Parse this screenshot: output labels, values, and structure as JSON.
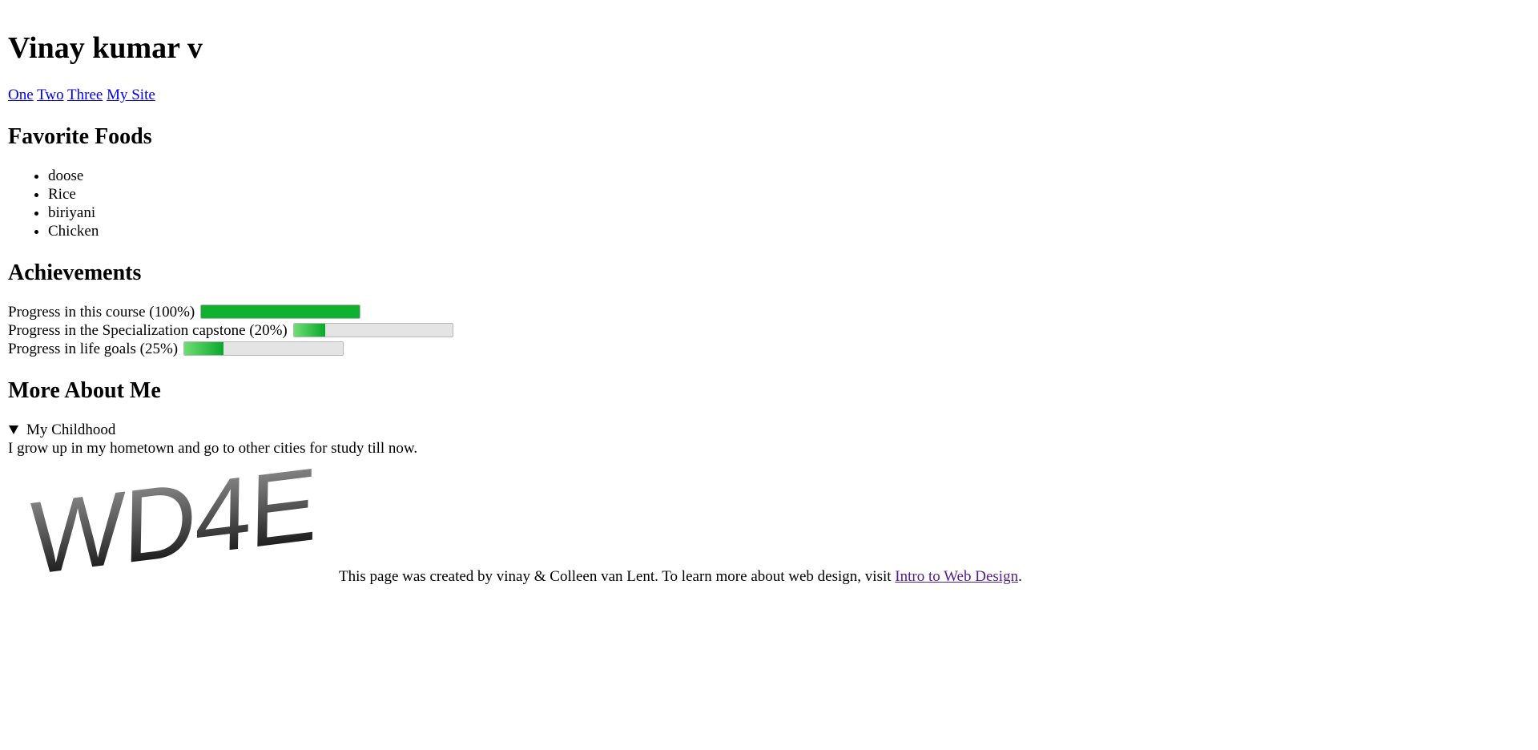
{
  "header": {
    "title": "Vinay kumar v"
  },
  "nav": {
    "links": [
      "One",
      "Two",
      "Three",
      "My Site"
    ]
  },
  "foods": {
    "heading": "Favorite Foods",
    "items": [
      "doose",
      "Rice",
      "biriyani",
      "Chicken"
    ]
  },
  "achievements": {
    "heading": "Achievements",
    "items": [
      {
        "label": "Progress in this course (100%)",
        "value": 100
      },
      {
        "label": "Progress in the Specialization capstone (20%)",
        "value": 20
      },
      {
        "label": "Progress in life goals (25%)",
        "value": 25
      }
    ]
  },
  "about": {
    "heading": "More About Me",
    "summary": "My Childhood",
    "body": "I grow up in my hometown and go to other cities for study till now."
  },
  "footer": {
    "logo_text": "WD4E",
    "text_before": "This page was created by vinay & Colleen van Lent. To learn more about web design, visit ",
    "link_text": "Intro to Web Design",
    "text_after": "."
  },
  "colors": {
    "link": "#0000ee",
    "visited_link": "#551a8b",
    "progress_fill": "#0fb22f",
    "progress_track": "#e4e4e4"
  }
}
